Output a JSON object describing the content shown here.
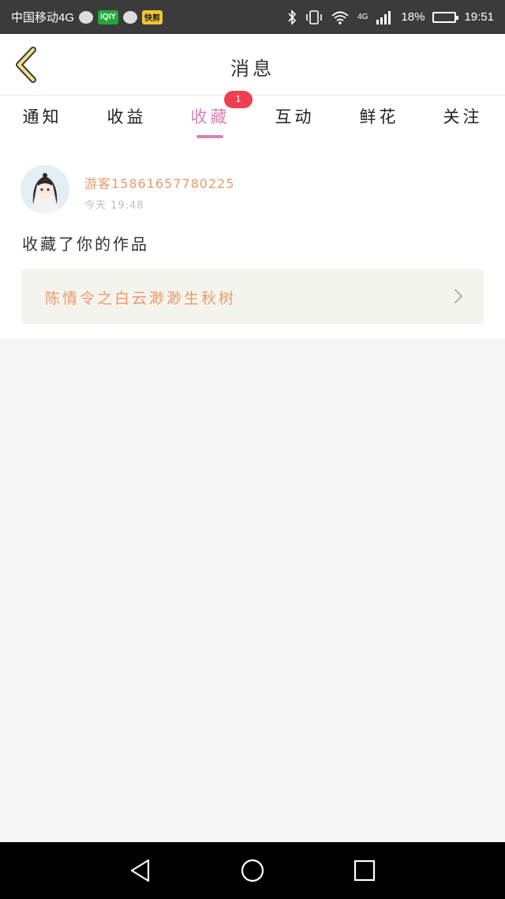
{
  "status_bar": {
    "carrier": "中国移动4G",
    "app_badge_1": "iQIY",
    "app_badge_2": "快剪",
    "network": "4G",
    "battery": "18%",
    "time": "19:51"
  },
  "header": {
    "title": "消息"
  },
  "tabs": [
    {
      "label": "通知"
    },
    {
      "label": "收益"
    },
    {
      "label": "收藏",
      "active": true,
      "badge": "1"
    },
    {
      "label": "互动"
    },
    {
      "label": "鲜花"
    },
    {
      "label": "关注"
    }
  ],
  "notification": {
    "username": "游客15861657780225",
    "time": "今天 19:48",
    "action": "收藏了你的作品",
    "work_title": "陈情令之白云渺渺生秋树"
  },
  "colors": {
    "accent_pink": "#d981b0",
    "accent_orange": "#e99a6a",
    "badge_red": "#ee3f4f"
  },
  "icons": {
    "back": "chevron-left-icon",
    "work_arrow": "chevron-right-icon",
    "nav_back": "triangle-back-icon",
    "nav_home": "circle-home-icon",
    "nav_recent": "square-recent-icon"
  }
}
